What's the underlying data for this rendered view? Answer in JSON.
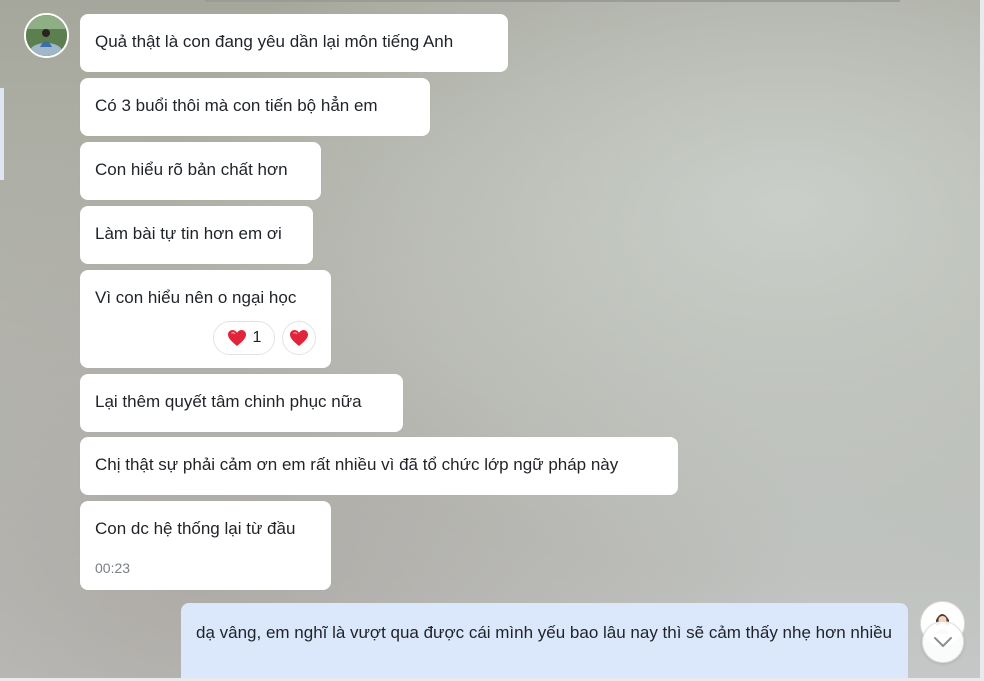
{
  "conversation": {
    "received": [
      {
        "text": "Quả thật là con đang yêu dần lại môn tiếng Anh"
      },
      {
        "text": "Có 3 buổi thôi mà con tiến bộ hẳn em"
      },
      {
        "text": "Con hiểu rõ bản chất hơn"
      },
      {
        "text": "Làm bài tự tin hơn em ơi"
      },
      {
        "text": "Vì con hiểu nên o ngại học",
        "reaction_emoji": "heart-icon",
        "reaction_count": "1"
      },
      {
        "text": "Lại thêm quyết tâm chinh phục nữa"
      },
      {
        "text": "Chị thật sự phải cảm ơn em rất nhiều vì đã tổ chức lớp ngữ pháp này"
      },
      {
        "text": "Con dc hệ thống lại từ đầu",
        "time": "00:23"
      }
    ],
    "sent": [
      {
        "text": "dạ vâng, em nghĩ là vượt qua được cái mình yếu bao lâu nay thì sẽ cảm thấy nhẹ hơn nhiều"
      }
    ]
  },
  "colors": {
    "received_bubble": "#ffffff",
    "sent_bubble": "#dbe8fc",
    "heart": "#e0243a",
    "timestamp": "#7b7f86"
  },
  "icons": {
    "scroll_down": "chevron-down-icon",
    "reaction": "heart-icon"
  }
}
